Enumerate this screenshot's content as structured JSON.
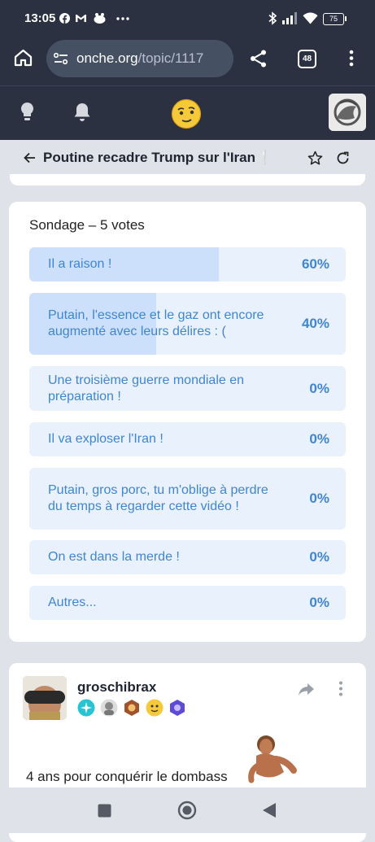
{
  "status_bar": {
    "time": "13:05",
    "battery": "75",
    "left_icons": [
      "facebook-icon",
      "gmail-icon",
      "app-icon",
      "more-icon"
    ],
    "right_icons": [
      "bluetooth-icon",
      "signal-icon",
      "wifi-icon",
      "battery-icon"
    ]
  },
  "browser": {
    "url_host": "onche.org",
    "url_path": "/topic/1117",
    "tab_count": "48"
  },
  "topic": {
    "title": "Poutine recadre Trump sur l'Iran❕"
  },
  "poll": {
    "title": "Sondage – 5 votes",
    "options": [
      {
        "label": "Il a raison !",
        "percent": "60%",
        "fraction": 0.6
      },
      {
        "label": "Putain, l'essence et le gaz ont encore augmenté avec leurs délires : (",
        "percent": "40%",
        "fraction": 0.4
      },
      {
        "label": "Une troisième guerre mondiale en préparation !",
        "percent": "0%",
        "fraction": 0
      },
      {
        "label": "Il va exploser l'Iran !",
        "percent": "0%",
        "fraction": 0
      },
      {
        "label": "Putain, gros porc, tu m'oblige à perdre du temps à regarder cette vidéo !",
        "percent": "0%",
        "fraction": 0
      },
      {
        "label": "On est dans la merde !",
        "percent": "0%",
        "fraction": 0
      },
      {
        "label": "Autres...",
        "percent": "0%",
        "fraction": 0
      }
    ]
  },
  "post": {
    "username": "groschibrax",
    "text": "4 ans pour conquérir le dombass"
  },
  "colors": {
    "dark_bar": "#2b3141",
    "url_pill": "#465063",
    "poll_option_bg": "#e9f1fd",
    "poll_option_fill": "#cde0fb",
    "poll_text": "#3f86cf",
    "page_bg": "#dfe2e8"
  }
}
